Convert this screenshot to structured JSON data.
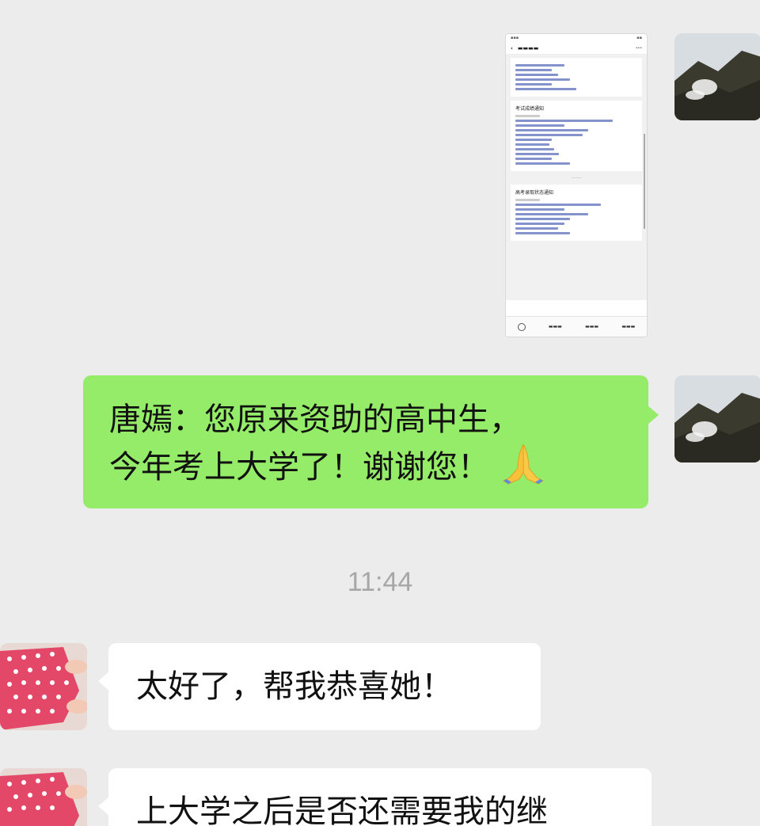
{
  "messages": [
    {
      "type": "image",
      "side": "right",
      "screenshot": {
        "card1_title": "考试成绩通知",
        "card2_title": "高考录取状态通知"
      }
    },
    {
      "type": "text",
      "side": "right",
      "line1": "唐嫣：您原来资助的高中生，",
      "line2": "今年考上大学了！谢谢您！",
      "emoji": "folded-hands"
    },
    {
      "type": "time",
      "text": "11:44"
    },
    {
      "type": "text",
      "side": "left",
      "text": "太好了，帮我恭喜她！"
    },
    {
      "type": "text",
      "side": "left",
      "text": "上大学之后是否还需要我的继"
    }
  ],
  "colors": {
    "background": "#ececec",
    "green_bubble": "#95ec69",
    "white_bubble": "#ffffff",
    "timestamp": "#a7a7a7"
  }
}
